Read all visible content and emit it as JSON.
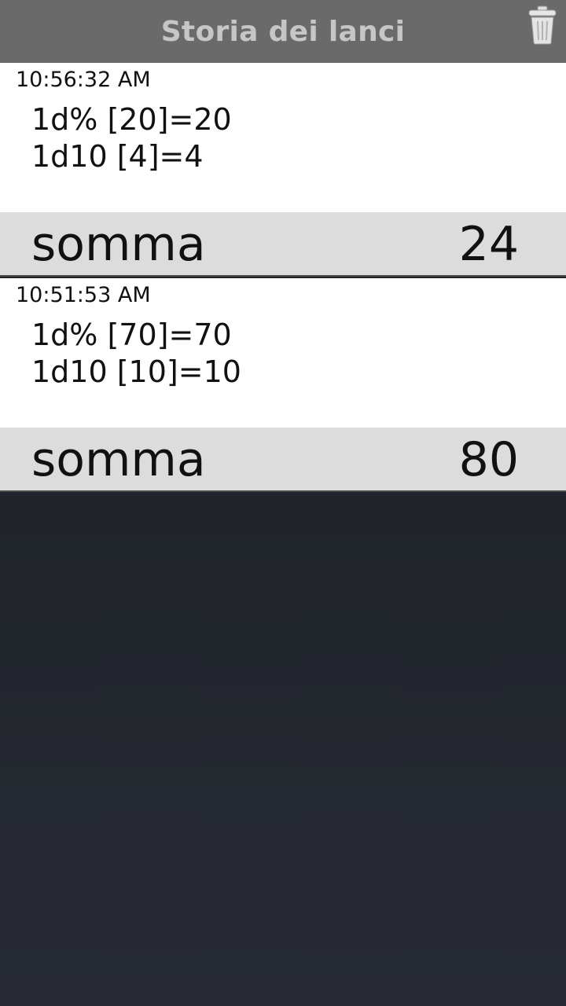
{
  "header": {
    "title": "Storia dei lanci",
    "delete_icon": "trash-icon"
  },
  "history": [
    {
      "time": "10:56:32 AM",
      "rolls": [
        "1d% [20]=20",
        "1d10 [4]=4"
      ],
      "sum_label": "somma",
      "sum_value": "24"
    },
    {
      "time": "10:51:53 AM",
      "rolls": [
        "1d% [70]=70",
        "1d10 [10]=10"
      ],
      "sum_label": "somma",
      "sum_value": "80"
    }
  ],
  "colors": {
    "topbar": "#6a6a6a",
    "title": "#c6c6c6",
    "sum_row": "#dcdcdc",
    "background": "#1c1f24"
  }
}
